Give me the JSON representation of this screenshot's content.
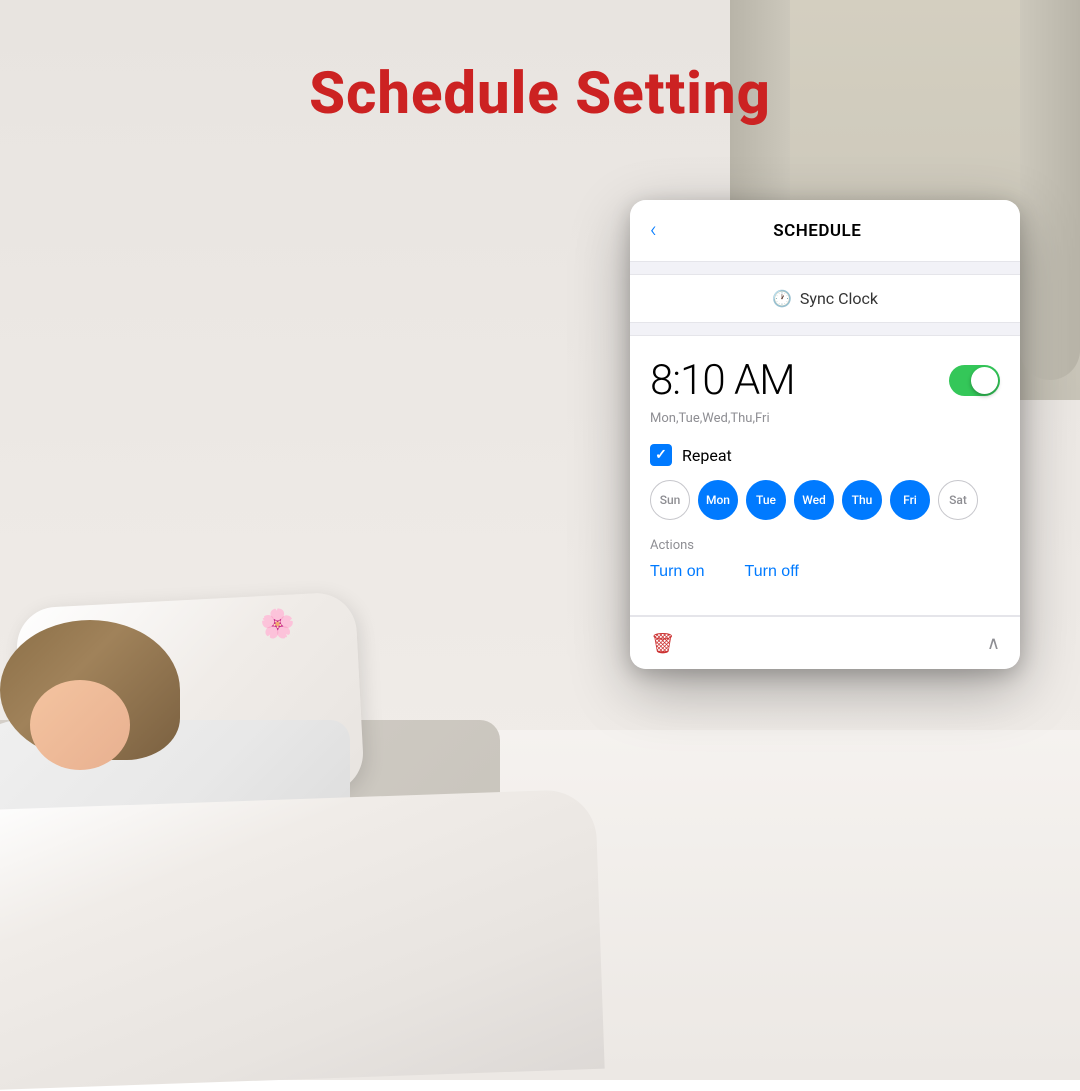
{
  "page": {
    "title": "Schedule Setting",
    "title_color": "#cc2222"
  },
  "background": {
    "description": "woman sleeping on white bed"
  },
  "phone_ui": {
    "header": {
      "back_label": "‹",
      "title": "SCHEDULE"
    },
    "sync_clock": {
      "icon": "🕐",
      "label": "Sync Clock"
    },
    "schedule": {
      "time": "8:10 AM",
      "days_active": "Mon,Tue,Wed,Thu,Fri",
      "toggle_on": true,
      "repeat": {
        "label": "Repeat",
        "checked": true
      },
      "days": [
        {
          "label": "Sun",
          "state": "inactive"
        },
        {
          "label": "Mon",
          "state": "active"
        },
        {
          "label": "Tue",
          "state": "active"
        },
        {
          "label": "Wed",
          "state": "active"
        },
        {
          "label": "Thu",
          "state": "active"
        },
        {
          "label": "Fri",
          "state": "active"
        },
        {
          "label": "Sat",
          "state": "inactive"
        }
      ],
      "actions": {
        "label": "Actions",
        "turn_on": "Turn on",
        "turn_off": "Turn off"
      }
    },
    "bottom": {
      "delete_icon": "🗑",
      "chevron": "∧"
    }
  }
}
